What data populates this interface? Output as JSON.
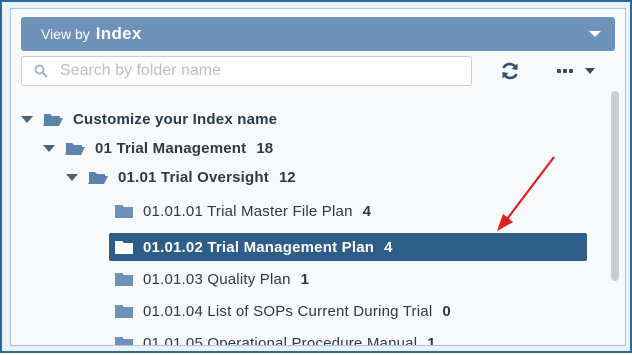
{
  "view_by": {
    "label": "View by",
    "value": "Index"
  },
  "search": {
    "placeholder": "Search by folder name",
    "value": ""
  },
  "colors": {
    "header_bg": "#6f93b8",
    "selected_bg": "#2e5d8a",
    "folder_icon": "#5b84ad",
    "annotation_arrow": "#e02020"
  },
  "tree": {
    "root": {
      "label": "Customize your Index name",
      "count": ""
    },
    "level1": {
      "label": "01 Trial Management",
      "count": "18"
    },
    "level2": {
      "label": "01.01 Trial Oversight",
      "count": "12"
    },
    "items": [
      {
        "label": "01.01.01 Trial Master File Plan",
        "count": "4"
      },
      {
        "label": "01.01.02 Trial Management Plan",
        "count": "4"
      },
      {
        "label": "01.01.03 Quality Plan",
        "count": "1"
      },
      {
        "label": "01.01.04 List of SOPs Current During Trial",
        "count": "0"
      },
      {
        "label": "01.01.05 Operational Procedure Manual",
        "count": "1"
      }
    ]
  },
  "selected_item": "01.01.02 Trial Management Plan",
  "icons": {
    "search": "search-icon",
    "refresh": "refresh-icon",
    "more": "more-options-icon",
    "folder_open": "folder-open-icon",
    "folder_closed": "folder-icon",
    "annotation": "red-arrow-annotation"
  }
}
